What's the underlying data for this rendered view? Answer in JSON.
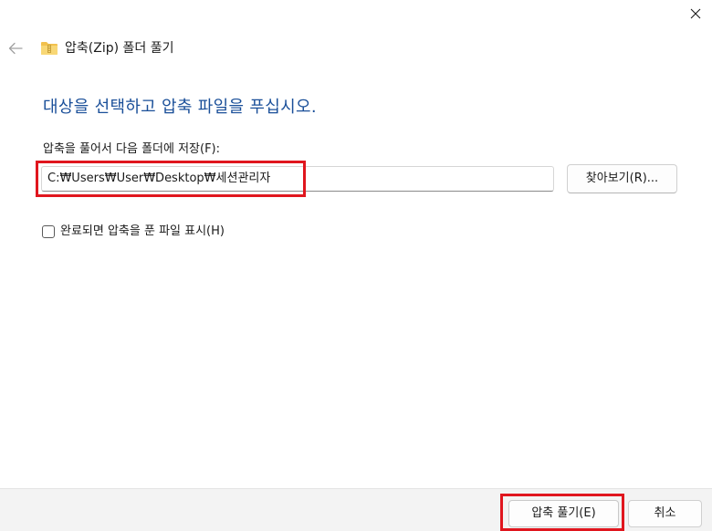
{
  "window": {
    "title": "압축(Zip) 폴더 풀기"
  },
  "main": {
    "heading": "대상을 선택하고 압축 파일을 푸십시오.",
    "destination_label": "압축을 풀어서 다음 폴더에 저장(F):",
    "destination_value": "C:₩Users₩User₩Desktop₩세션관리자",
    "browse_label": "찾아보기(R)...",
    "show_files_label": "완료되면 압축을 푼 파일 표시(H)",
    "show_files_checked": false
  },
  "footer": {
    "extract_label": "압축 풀기(E)",
    "cancel_label": "취소"
  },
  "icons": {
    "close": "close-icon",
    "back": "back-arrow-icon",
    "folder": "zip-folder-icon"
  },
  "colors": {
    "heading": "#1a4f99",
    "highlight": "#e0161e",
    "footer_bg": "#f3f3f3"
  }
}
